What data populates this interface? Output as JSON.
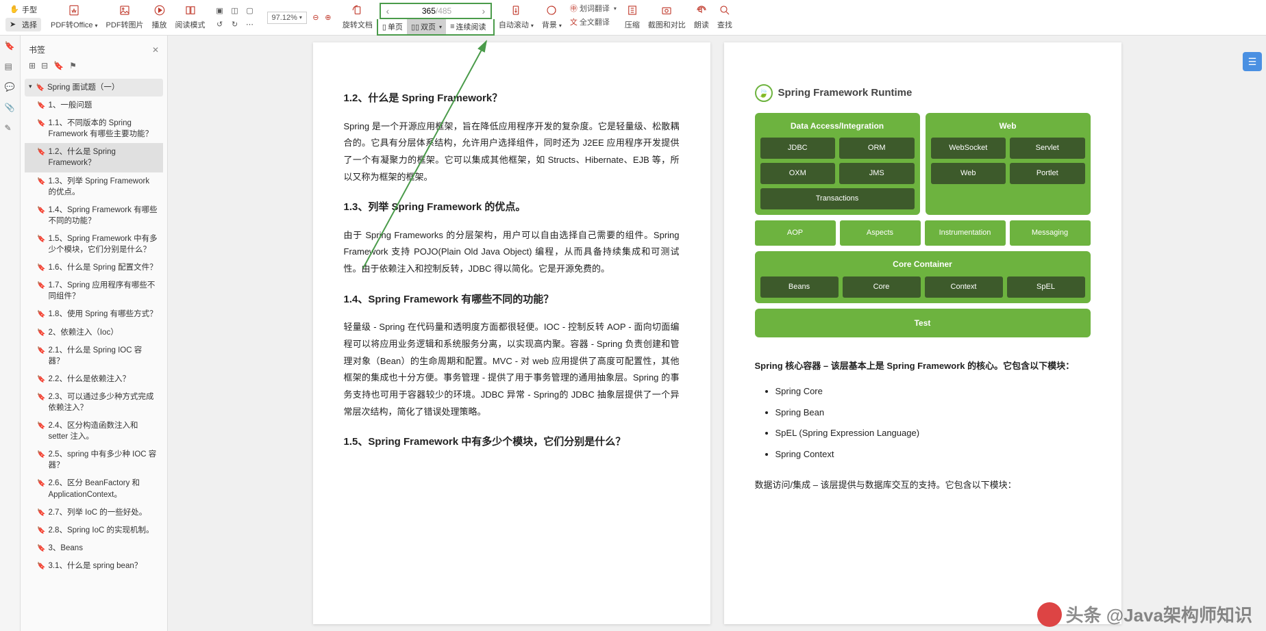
{
  "toolbar": {
    "hand": "手型",
    "select": "选择",
    "pdf_office": "PDF转Office",
    "pdf_img": "PDF转图片",
    "play": "播放",
    "read_mode": "阅读模式",
    "rotate": "旋转文档",
    "zoom": "97.12%",
    "page_current": "365",
    "page_total": "/485",
    "single": "单页",
    "double": "双页",
    "continuous": "连续阅读",
    "auto_scroll": "自动滚动",
    "background": "背景",
    "word_trans": "划词翻译",
    "full_trans": "全文翻译",
    "compress": "压缩",
    "screenshot": "截图和对比",
    "read_aloud": "朗读",
    "find": "查找"
  },
  "sidebar": {
    "title": "书签",
    "root": "Spring 面试题（一）",
    "items": [
      "1、一般问题",
      "1.1、不同版本的 Spring Framework 有哪些主要功能？",
      "1.2、什么是 Spring Framework？",
      "1.3、列举 Spring Framework 的优点。",
      "1.4、Spring Framework 有哪些不同的功能？",
      "1.5、Spring Framework 中有多少个模块，它们分别是什么？",
      "1.6、什么是 Spring 配置文件？",
      "1.7、Spring 应用程序有哪些不同组件？",
      "1.8、使用 Spring 有哪些方式？",
      "2、依赖注入（Ioc）",
      "2.1、什么是 Spring IOC 容器？",
      "2.2、什么是依赖注入？",
      "2.3、可以通过多少种方式完成依赖注入？",
      "2.4、区分构造函数注入和 setter 注入。",
      "2.5、spring 中有多少种 IOC 容器？",
      "2.6、区分 BeanFactory 和 ApplicationContext。",
      "2.7、列举 IoC 的一些好处。",
      "2.8、Spring IoC 的实现机制。",
      "3、Beans",
      "3.1、什么是 spring bean？"
    ],
    "selected": 2
  },
  "left_page": {
    "h12": "1.2、什么是 Spring Framework？",
    "p12": "Spring 是一个开源应用框架，旨在降低应用程序开发的复杂度。它是轻量级、松散耦合的。它具有分层体系结构，允许用户选择组件，同时还为 J2EE 应用程序开发提供了一个有凝聚力的框架。它可以集成其他框架，如 Structs、Hibernate、EJB 等，所以又称为框架的框架。",
    "h13": "1.3、列举 Spring Framework 的优点。",
    "p13": "由于 Spring Frameworks 的分层架构，用户可以自由选择自己需要的组件。Spring Framework 支持 POJO(Plain Old Java Object) 编程，从而具备持续集成和可测试性。由于依赖注入和控制反转，JDBC 得以简化。它是开源免费的。",
    "h14": "1.4、Spring Framework 有哪些不同的功能？",
    "p14": "轻量级 - Spring 在代码量和透明度方面都很轻便。IOC - 控制反转 AOP - 面向切面编程可以将应用业务逻辑和系统服务分离，以实现高内聚。容器 - Spring 负责创建和管理对象（Bean）的生命周期和配置。MVC - 对 web 应用提供了高度可配置性，其他框架的集成也十分方便。事务管理 - 提供了用于事务管理的通用抽象层。Spring 的事务支持也可用于容器较少的环境。JDBC 异常 - Spring的 JDBC 抽象层提供了一个异常层次结构，简化了错误处理策略。",
    "h15": "1.5、Spring Framework 中有多少个模块，它们分别是什么？"
  },
  "right_page": {
    "diag_title": "Spring Framework Runtime",
    "sec1": "Data Access/Integration",
    "sec1_boxes": [
      "JDBC",
      "ORM",
      "OXM",
      "JMS",
      "Transactions"
    ],
    "sec2": "Web",
    "sec2_boxes": [
      "WebSocket",
      "Servlet",
      "Web",
      "Portlet"
    ],
    "mid": [
      "AOP",
      "Aspects",
      "Instrumentation",
      "Messaging"
    ],
    "sec3": "Core Container",
    "sec3_boxes": [
      "Beans",
      "Core",
      "Context",
      "SpEL"
    ],
    "sec4": "Test",
    "core_desc": "Spring 核心容器 – 该层基本上是 Spring Framework 的核心。它包含以下模块：",
    "bullets": [
      "Spring Core",
      "Spring Bean",
      "SpEL (Spring Expression Language)",
      "Spring Context"
    ],
    "data_access": "数据访问/集成 – 该层提供与数据库交互的支持。它包含以下模块："
  },
  "watermark": "头条 @Java架构师知识"
}
